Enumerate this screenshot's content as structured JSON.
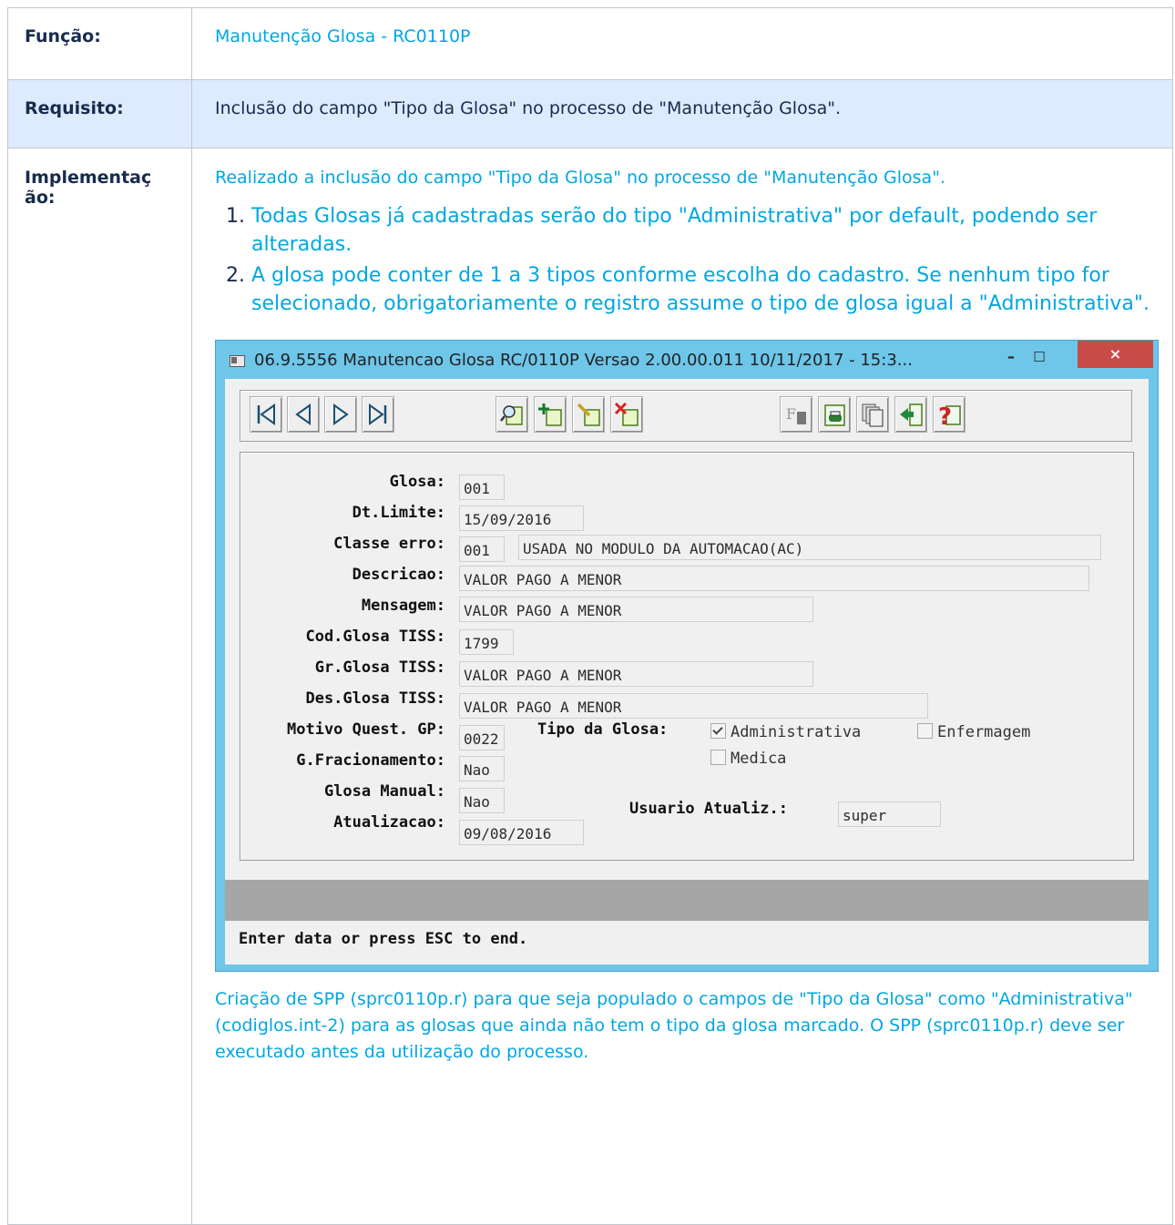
{
  "rows": {
    "funcao": {
      "label": "Função:",
      "value": "Manutenção Glosa - RC0110P"
    },
    "requisito": {
      "label": "Requisito:",
      "value": "Inclusão do campo \"Tipo da Glosa\" no processo de \"Manutenção Glosa\"."
    },
    "implementacao": {
      "label_line1": "Implementaç",
      "label_line2": "ão:",
      "intro": "Realizado a inclusão do campo \"Tipo da Glosa\" no processo de \"Manutenção Glosa\".",
      "items": [
        "Todas Glosas já cadastradas serão do tipo \"Administrativa\" por default, podendo ser alteradas.",
        "A glosa pode conter de 1 a 3 tipos conforme escolha do cadastro. Se nenhum tipo for selecionado, obrigatoriamente o registro assume o tipo de glosa igual a \"Administrativa\"."
      ],
      "after": "Criação de SPP (sprc0110p.r) para que seja populado o campos de \"Tipo da Glosa\" como \"Administrativa\"(codiglos.int-2) para as glosas que ainda não tem o tipo da glosa marcado. O SPP (sprc0110p.r) deve ser executado antes da utilização do processo."
    }
  },
  "window": {
    "title": "06.9.5556 Manutencao  Glosa RC/0110P Versao 2.00.00.011 10/11/2017 - 15:3...",
    "minimize": "–",
    "maximize": "☐",
    "close": "×",
    "toolbar_icons": [
      "first-icon",
      "prev-icon",
      "next-icon",
      "last-icon",
      "search-icon",
      "add-icon",
      "edit-icon",
      "delete-icon",
      "filter-icon",
      "print-icon",
      "copy-icon",
      "exit-icon",
      "help-icon"
    ],
    "fields": {
      "glosa": {
        "label": "Glosa:",
        "value": "001"
      },
      "dt_limite": {
        "label": "Dt.Limite:",
        "value": "15/09/2016"
      },
      "classe_erro": {
        "label": "Classe erro:",
        "code": "001",
        "desc": "USADA NO MODULO DA AUTOMACAO(AC)"
      },
      "descricao": {
        "label": "Descricao:",
        "value": "VALOR PAGO A MENOR"
      },
      "mensagem": {
        "label": "Mensagem:",
        "value": "VALOR PAGO A MENOR"
      },
      "cod_glosa_tiss": {
        "label": "Cod.Glosa TISS:",
        "value": "1799"
      },
      "gr_glosa_tiss": {
        "label": "Gr.Glosa TISS:",
        "value": "VALOR PAGO A MENOR"
      },
      "des_glosa_tiss": {
        "label": "Des.Glosa TISS:",
        "value": "VALOR PAGO A MENOR"
      },
      "motivo_quest": {
        "label": "Motivo Quest. GP:",
        "value": "0022"
      },
      "tipo_glosa": {
        "label": "Tipo da Glosa:",
        "administrativa": {
          "label": "Administrativa",
          "checked": true
        },
        "enfermagem": {
          "label": "Enfermagem",
          "checked": false
        },
        "medica": {
          "label": "Medica",
          "checked": false
        }
      },
      "g_fracionamento": {
        "label": "G.Fracionamento:",
        "value": "Nao"
      },
      "glosa_manual": {
        "label": "Glosa Manual:",
        "value": "Nao"
      },
      "usuario_atualiz": {
        "label": "Usuario Atualiz.:",
        "value": "super"
      },
      "atualizacao": {
        "label": "Atualizacao:",
        "value": "09/08/2016"
      }
    },
    "status": "Enter data or press ESC to end."
  }
}
